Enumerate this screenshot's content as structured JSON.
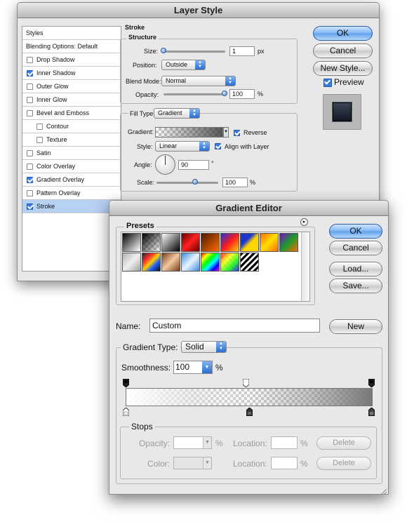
{
  "layer_style": {
    "title": "Layer Style",
    "styles_list": [
      {
        "label": "Styles",
        "checked": null
      },
      {
        "label": "Blending Options: Default",
        "checked": null
      },
      {
        "label": "Drop Shadow",
        "checked": false
      },
      {
        "label": "Inner Shadow",
        "checked": true
      },
      {
        "label": "Outer Glow",
        "checked": false
      },
      {
        "label": "Inner Glow",
        "checked": false
      },
      {
        "label": "Bevel and Emboss",
        "checked": false
      },
      {
        "label": "Contour",
        "checked": false
      },
      {
        "label": "Texture",
        "checked": false
      },
      {
        "label": "Satin",
        "checked": false
      },
      {
        "label": "Color Overlay",
        "checked": false
      },
      {
        "label": "Gradient Overlay",
        "checked": true
      },
      {
        "label": "Pattern Overlay",
        "checked": false
      },
      {
        "label": "Stroke",
        "checked": true
      }
    ],
    "stroke": {
      "group_label": "Stroke",
      "structure_label": "Structure",
      "size_label": "Size:",
      "size_value": "1",
      "size_unit": "px",
      "position_label": "Position:",
      "position_value": "Outside",
      "blend_mode_label": "Blend Mode:",
      "blend_mode_value": "Normal",
      "opacity_label": "Opacity:",
      "opacity_value": "100",
      "opacity_unit": "%",
      "fill_type_label": "Fill Type:",
      "fill_type_value": "Gradient",
      "gradient_label": "Gradient:",
      "reverse_label": "Reverse",
      "reverse_checked": true,
      "style_label": "Style:",
      "style_value": "Linear",
      "align_label": "Align with Layer",
      "align_checked": true,
      "angle_label": "Angle:",
      "angle_value": "90",
      "angle_unit": "°",
      "scale_label": "Scale:",
      "scale_value": "100",
      "scale_unit": "%"
    },
    "buttons": {
      "ok": "OK",
      "cancel": "Cancel",
      "new_style": "New Style...",
      "preview": "Preview",
      "preview_checked": true
    }
  },
  "gradient_editor": {
    "title": "Gradient Editor",
    "presets_label": "Presets",
    "buttons": {
      "ok": "OK",
      "cancel": "Cancel",
      "load": "Load...",
      "save": "Save...",
      "new": "New"
    },
    "name_label": "Name:",
    "name_value": "Custom",
    "gradient_type_label": "Gradient Type:",
    "gradient_type_value": "Solid",
    "smoothness_label": "Smoothness:",
    "smoothness_value": "100",
    "smoothness_unit": "%",
    "stops": {
      "label": "Stops",
      "opacity_label": "Opacity:",
      "opacity_unit": "%",
      "location_label": "Location:",
      "location_unit": "%",
      "color_label": "Color:",
      "delete_label": "Delete"
    }
  }
}
